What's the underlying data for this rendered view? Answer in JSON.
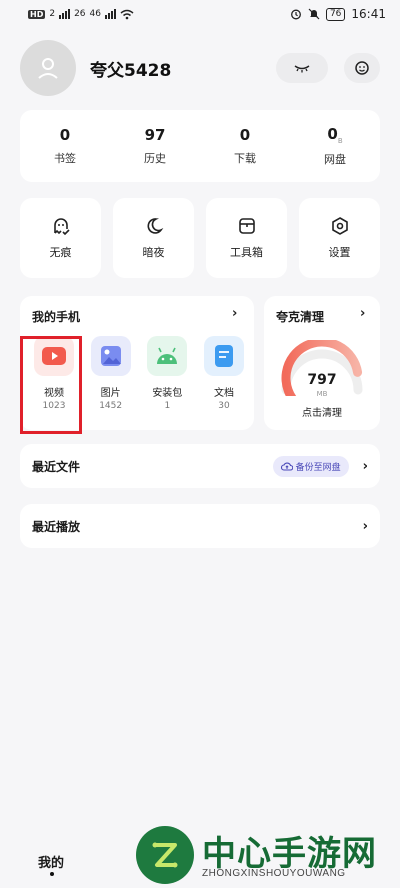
{
  "status_bar": {
    "left_indicators": [
      "HD",
      "2",
      "26",
      "46"
    ],
    "battery": "76",
    "time": "16:41"
  },
  "profile": {
    "username": "夸父5428"
  },
  "stats": [
    {
      "value": "0",
      "label": "书签"
    },
    {
      "value": "97",
      "label": "历史"
    },
    {
      "value": "0",
      "label": "下载"
    },
    {
      "value": "0",
      "unit": "B",
      "label": "网盘"
    }
  ],
  "tools": [
    {
      "label": "无痕",
      "icon": "incognito-ghost-icon"
    },
    {
      "label": "暗夜",
      "icon": "moon-icon"
    },
    {
      "label": "工具箱",
      "icon": "toolbox-icon"
    },
    {
      "label": "设置",
      "icon": "gear-icon"
    }
  ],
  "my_phone": {
    "title": "我的手机",
    "apps": [
      {
        "name": "视频",
        "count": "1023",
        "icon": "video-play-icon",
        "color": "#f25a4d"
      },
      {
        "name": "图片",
        "count": "1452",
        "icon": "image-icon",
        "color": "#6a7be8"
      },
      {
        "name": "安装包",
        "count": "1",
        "icon": "android-icon",
        "color": "#4cc07a"
      },
      {
        "name": "文档",
        "count": "30",
        "icon": "document-icon",
        "color": "#3c9bf0"
      }
    ]
  },
  "cleaner": {
    "title": "夸克清理",
    "value": "797",
    "unit": "MB",
    "action": "点击清理",
    "gauge_fraction": 0.8
  },
  "recent_files": {
    "title": "最近文件",
    "backup_label": "备份至网盘"
  },
  "recent_play": {
    "title": "最近播放"
  },
  "bottom_nav": {
    "mine": "我的"
  },
  "watermark": {
    "title": "中心手游网",
    "subtitle": "ZHONGXINSHOUYOUWANG"
  }
}
